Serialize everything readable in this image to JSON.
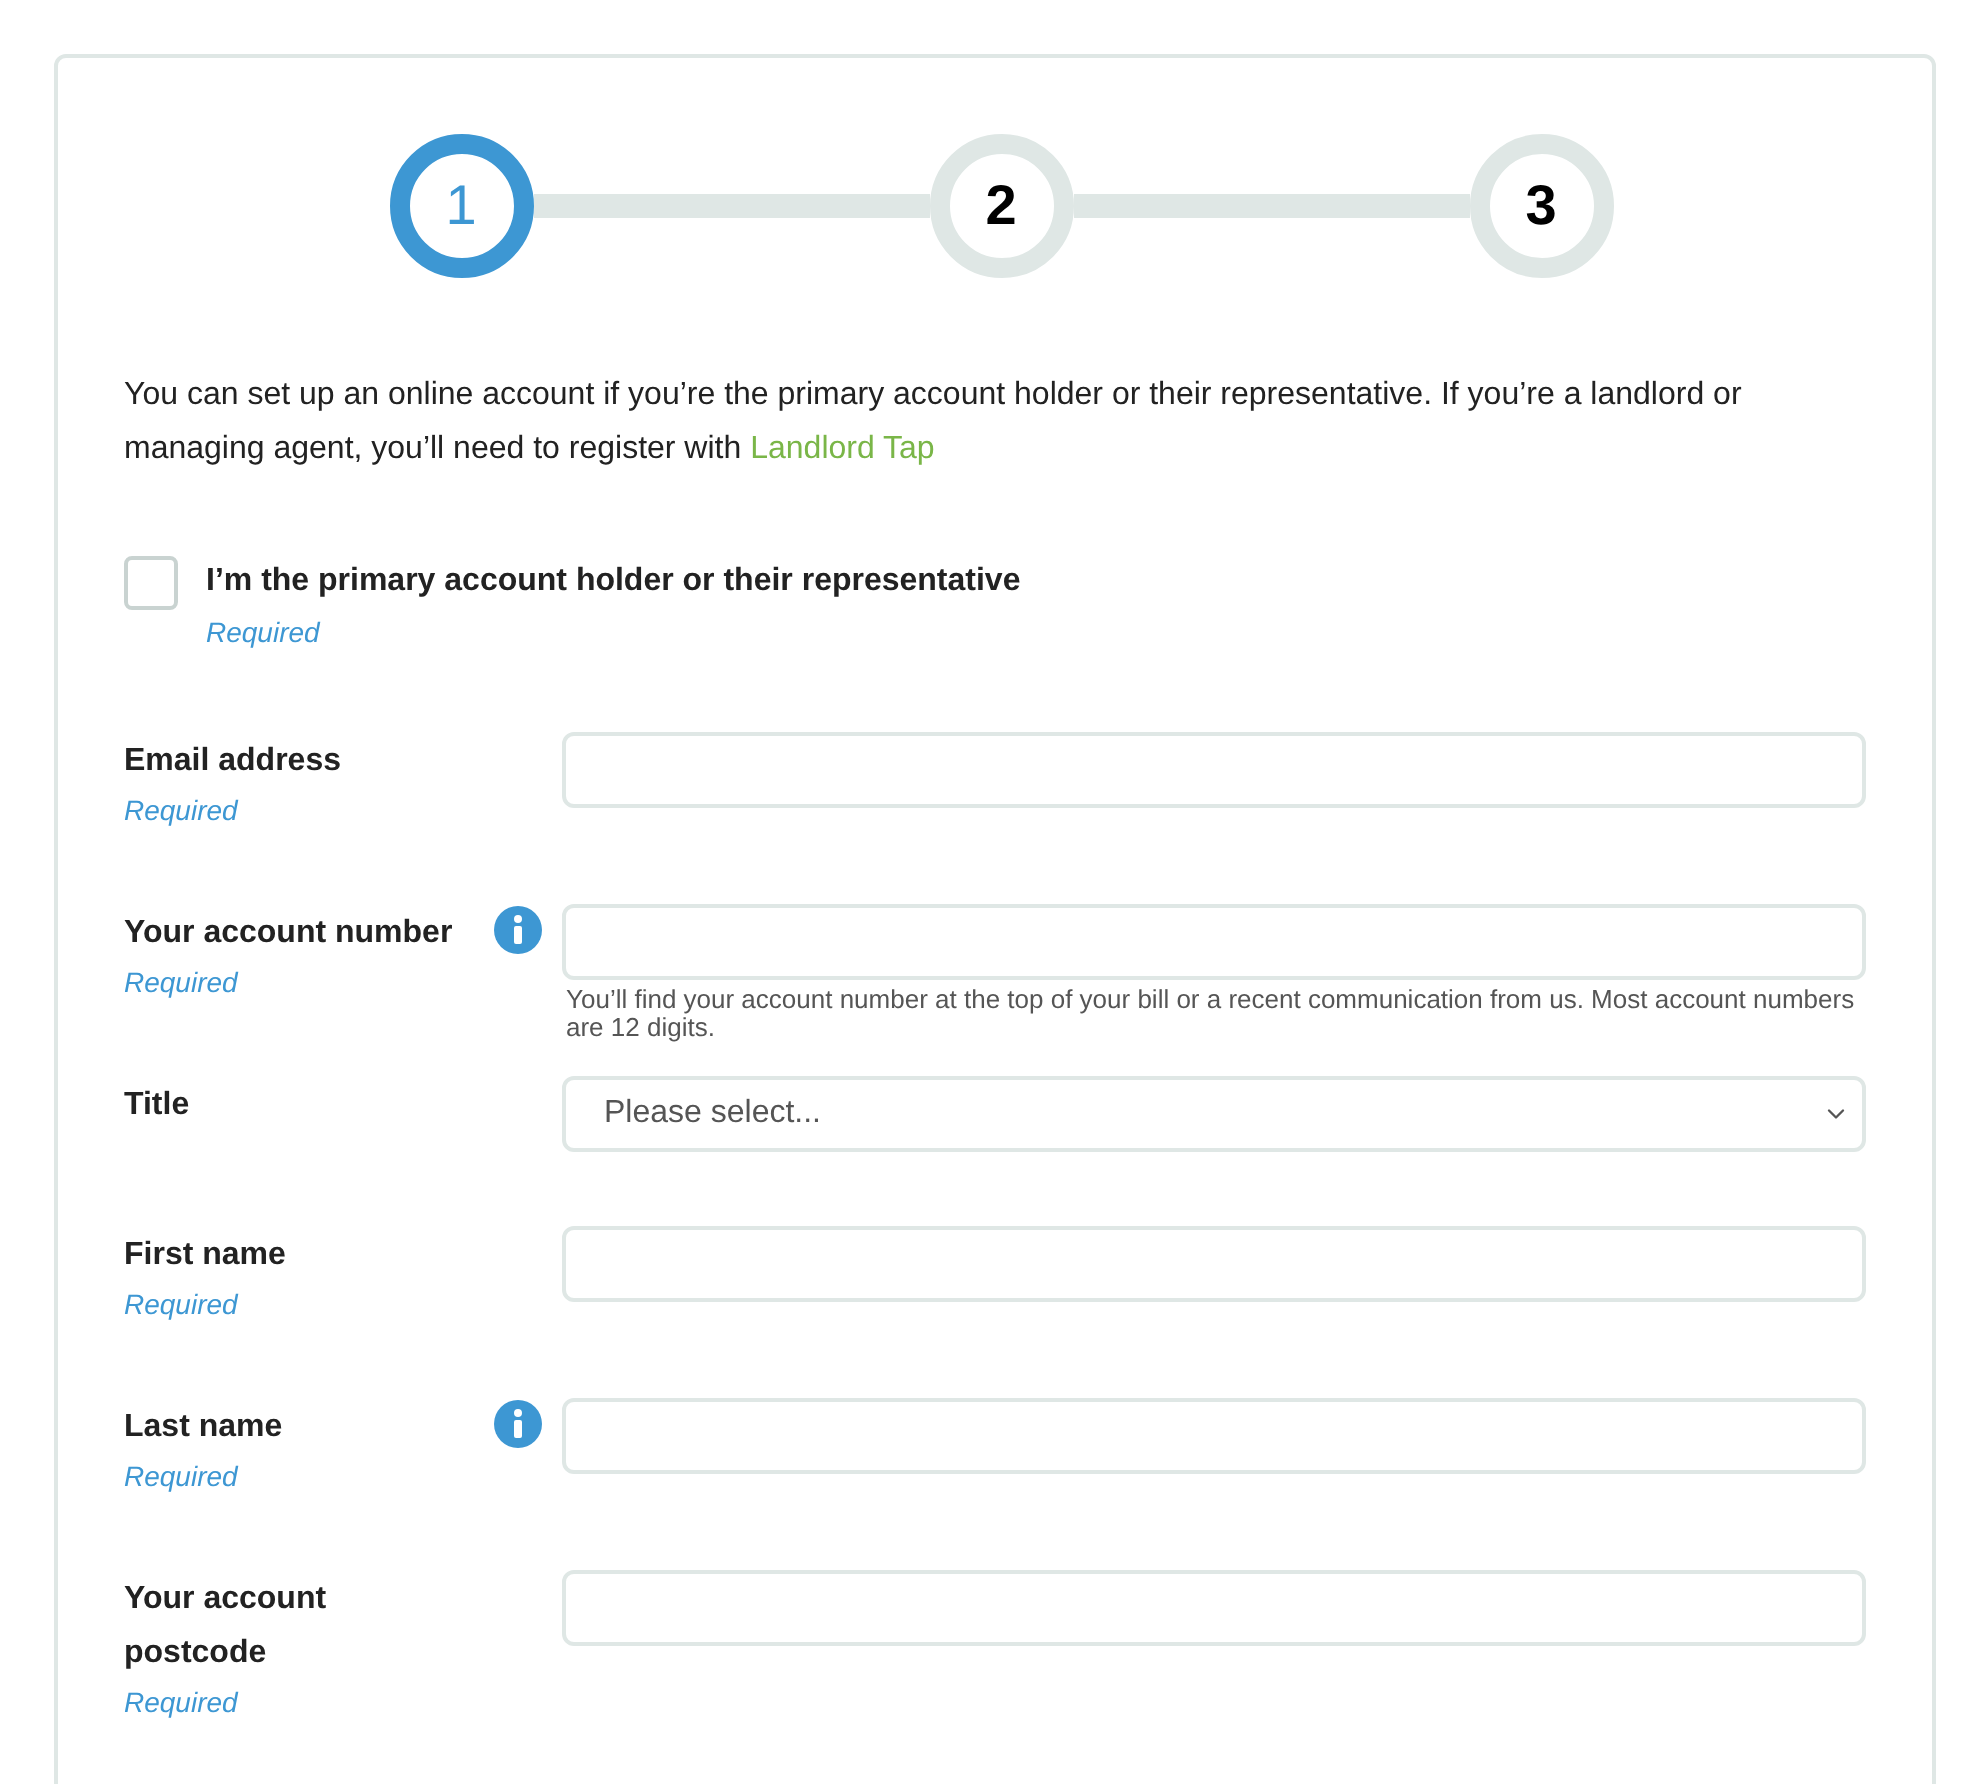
{
  "steps": [
    {
      "label": "1",
      "selected": true
    },
    {
      "label": "2",
      "selected": false
    },
    {
      "label": "3",
      "selected": false
    }
  ],
  "intro": {
    "text": "You can set up an online account if you’re the primary account holder or their representative. If you’re a landlord or managing agent, you’ll need to register with",
    "link": "Landlord Tap"
  },
  "confirm": {
    "label": "I’m the primary account holder or their representative",
    "checked": false,
    "required": "Required"
  },
  "fields": [
    {
      "kind": "text",
      "label": "Email address",
      "required": "Required",
      "info": false
    },
    {
      "kind": "text",
      "label": "Your account number",
      "required": "Required",
      "info": true,
      "hint": "You’ll find your account number at the top of your bill or a recent communication from us. Most account numbers are 12 digits."
    },
    {
      "kind": "select",
      "label": "Title",
      "placeholder": "Please select...",
      "info": false
    },
    {
      "kind": "text",
      "label": "First name",
      "required": "Required",
      "info": false
    },
    {
      "kind": "text",
      "label": "Last name",
      "required": "Required",
      "info": true
    },
    {
      "kind": "text",
      "label": "Your account postcode",
      "required": "Required",
      "info": false
    }
  ]
}
